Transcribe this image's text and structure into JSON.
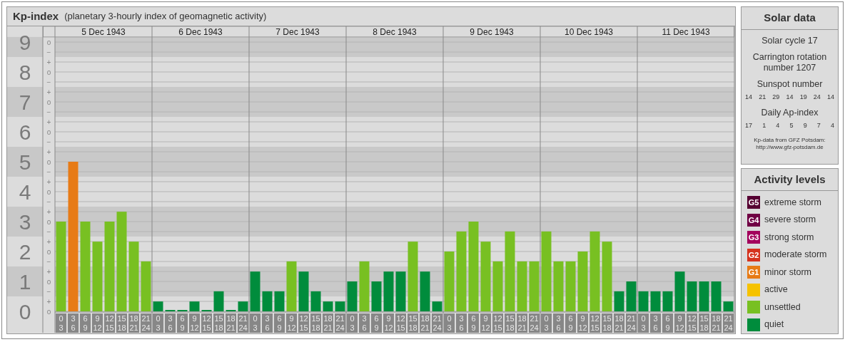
{
  "kp_panel": {
    "title": "Kp-index",
    "subtitle": "(planetary 3-hourly index of geomagnetic activity)",
    "days": [
      "5 Dec 1943",
      "6 Dec 1943",
      "7 Dec 1943",
      "8 Dec 1943",
      "9 Dec 1943",
      "10 Dec 1943",
      "11 Dec 1943"
    ],
    "sublevel_labels": [
      "o",
      "−",
      "+",
      "o",
      "−",
      "+",
      "o",
      "−",
      "+",
      "o",
      "−",
      "+",
      "o",
      "−",
      "+",
      "o",
      "−",
      "+",
      "o",
      "−",
      "+",
      "o",
      "−",
      "+",
      "o",
      "−",
      "+",
      "o"
    ],
    "chart_data": {
      "type": "bar",
      "grid": true,
      "categories": [
        "0 3",
        "3 6",
        "6 9",
        "9 12",
        "12 15",
        "15 18",
        "18 21",
        "21 24",
        "0 3",
        "3 6",
        "6 9",
        "9 12",
        "12 15",
        "15 18",
        "18 21",
        "21 24",
        "0 3",
        "3 6",
        "6 9",
        "9 12",
        "12 15",
        "15 18",
        "18 21",
        "21 24",
        "0 3",
        "3 6",
        "6 9",
        "9 12",
        "12 15",
        "15 18",
        "18 21",
        "21 24",
        "0 3",
        "3 6",
        "6 9",
        "9 12",
        "12 15",
        "15 18",
        "18 21",
        "21 24",
        "0 3",
        "3 6",
        "6 9",
        "9 12",
        "12 15",
        "15 18",
        "18 21",
        "21 24",
        "0 3",
        "3 6",
        "6 9",
        "9 12",
        "12 15",
        "15 18",
        "18 21",
        "21 24"
      ],
      "values": [
        3,
        5,
        3,
        2.33,
        3,
        3.33,
        2.33,
        1.67,
        0.33,
        0,
        0,
        0.33,
        0,
        0.67,
        0,
        0.33,
        1.33,
        0.67,
        0.67,
        1.67,
        1.33,
        0.67,
        0.33,
        0.33,
        1,
        1.67,
        1,
        1.33,
        1.33,
        2.33,
        1.33,
        0.33,
        2,
        2.67,
        3,
        2.33,
        1.67,
        2.67,
        1.67,
        1.67,
        2.67,
        1.67,
        1.67,
        2,
        2.67,
        2.33,
        0.67,
        1,
        0.67,
        0.67,
        0.67,
        1.33,
        1,
        1,
        1,
        0.33
      ],
      "ylim": [
        0,
        9.17
      ],
      "bands": [
        {
          "axis": "y",
          "from": 0.5,
          "to": 1.5
        },
        {
          "axis": "y",
          "from": 2.5,
          "to": 3.5
        },
        {
          "axis": "y",
          "from": 4.5,
          "to": 5.5
        },
        {
          "axis": "y",
          "from": 6.5,
          "to": 7.5
        },
        {
          "axis": "y",
          "from": 8.5,
          "to": 9.17
        }
      ],
      "yticks": [
        {
          "value": 0,
          "label": "0"
        },
        {
          "value": 1,
          "label": "1"
        },
        {
          "value": 2,
          "label": "2"
        },
        {
          "value": 3,
          "label": "3"
        },
        {
          "value": 4,
          "label": "4"
        },
        {
          "value": 5,
          "label": "5"
        },
        {
          "value": 6,
          "label": "6"
        },
        {
          "value": 7,
          "label": "7"
        },
        {
          "value": 8,
          "label": "8"
        },
        {
          "value": 9,
          "label": "9"
        }
      ]
    }
  },
  "solar_data": {
    "title": "Solar data",
    "cycle": "Solar cycle 17",
    "rotation": "Carrington rotation number 1207",
    "sunspot_label": "Sunspot number",
    "sunspot_values": [
      "14",
      "21",
      "29",
      "14",
      "19",
      "24",
      "14"
    ],
    "ap_label": "Daily Ap-index",
    "ap_values": [
      "17",
      "1",
      "4",
      "5",
      "9",
      "7",
      "4"
    ],
    "source_note": "Kp-data from GFZ Potsdam:",
    "source_url": "http://www.gfz-potsdam.de"
  },
  "activity_levels": {
    "title": "Activity levels",
    "items": [
      {
        "badge": "G5",
        "label": "extreme storm",
        "color": "#560032"
      },
      {
        "badge": "G4",
        "label": "severe storm",
        "color": "#700044"
      },
      {
        "badge": "G3",
        "label": "strong storm",
        "color": "#a3005c"
      },
      {
        "badge": "G2",
        "label": "moderate storm",
        "color": "#d5321e"
      },
      {
        "badge": "G1",
        "label": "minor storm",
        "color": "#e77b16"
      },
      {
        "label": "active",
        "color": "#f6c200"
      },
      {
        "label": "unsettled",
        "color": "#78c022"
      },
      {
        "label": "quiet",
        "color": "#008c3c"
      }
    ]
  }
}
